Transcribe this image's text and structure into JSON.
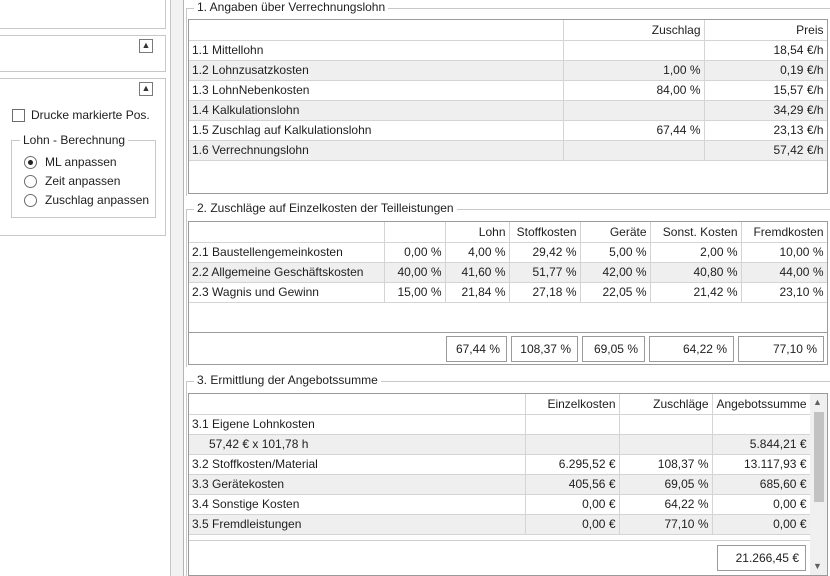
{
  "sidebar": {
    "print_marked_label": "Drucke markierte Pos.",
    "lohn_group_title": "Lohn - Berechnung",
    "options": [
      {
        "label": "ML anpassen",
        "selected": true
      },
      {
        "label": "Zeit anpassen",
        "selected": false
      },
      {
        "label": "Zuschlag anpassen",
        "selected": false
      }
    ]
  },
  "section1": {
    "title": "1. Angaben über Verrechnungslohn",
    "headers": [
      "",
      "Zuschlag",
      "Preis"
    ],
    "rows": [
      [
        "1.1 Mittellohn",
        "",
        "18,54 €/h"
      ],
      [
        "1.2 Lohnzusatzkosten",
        "1,00 %",
        "0,19 €/h"
      ],
      [
        "1.3 LohnNebenkosten",
        "84,00 %",
        "15,57 €/h"
      ],
      [
        "1.4 Kalkulationslohn",
        "",
        "34,29 €/h"
      ],
      [
        "1.5 Zuschlag auf Kalkulationslohn",
        "67,44 %",
        "23,13 €/h"
      ],
      [
        "1.6 Verrechnungslohn",
        "",
        "57,42 €/h"
      ]
    ]
  },
  "section2": {
    "title": "2. Zuschläge auf Einzelkosten der Teilleistungen",
    "headers": [
      "",
      "",
      "Lohn",
      "Stoffkosten",
      "Geräte",
      "Sonst. Kosten",
      "Fremdkosten"
    ],
    "rows": [
      [
        "2.1 Baustellengemeinkosten",
        "0,00 %",
        "4,00 %",
        "29,42 %",
        "5,00 %",
        "2,00 %",
        "10,00 %"
      ],
      [
        "2.2 Allgemeine Geschäftskosten",
        "40,00 %",
        "41,60 %",
        "51,77 %",
        "42,00 %",
        "40,80 %",
        "44,00 %"
      ],
      [
        "2.3 Wagnis und Gewinn",
        "15,00 %",
        "21,84 %",
        "27,18 %",
        "22,05 %",
        "21,42 %",
        "23,10 %"
      ]
    ],
    "totals": [
      "67,44 %",
      "108,37 %",
      "69,05 %",
      "64,22 %",
      "77,10 %"
    ]
  },
  "section3": {
    "title": "3. Ermittlung der Angebotssumme",
    "headers": [
      "",
      "Einzelkosten",
      "Zuschläge",
      "Angebotssumme"
    ],
    "rows": [
      [
        "3.1 Eigene Lohnkosten",
        "",
        "",
        ""
      ],
      [
        "57,42 € x 101,78 h",
        "",
        "",
        "5.844,21 €"
      ],
      [
        "3.2 Stoffkosten/Material",
        "6.295,52 €",
        "108,37 %",
        "13.117,93 €"
      ],
      [
        "3.3 Gerätekosten",
        "405,56 €",
        "69,05 %",
        "685,60 €"
      ],
      [
        "3.4 Sonstige Kosten",
        "0,00 €",
        "64,22 %",
        "0,00 €"
      ],
      [
        "3.5 Fremdleistungen",
        "0,00 €",
        "77,10 %",
        "0,00 €"
      ]
    ],
    "total": "21.266,45 €"
  }
}
